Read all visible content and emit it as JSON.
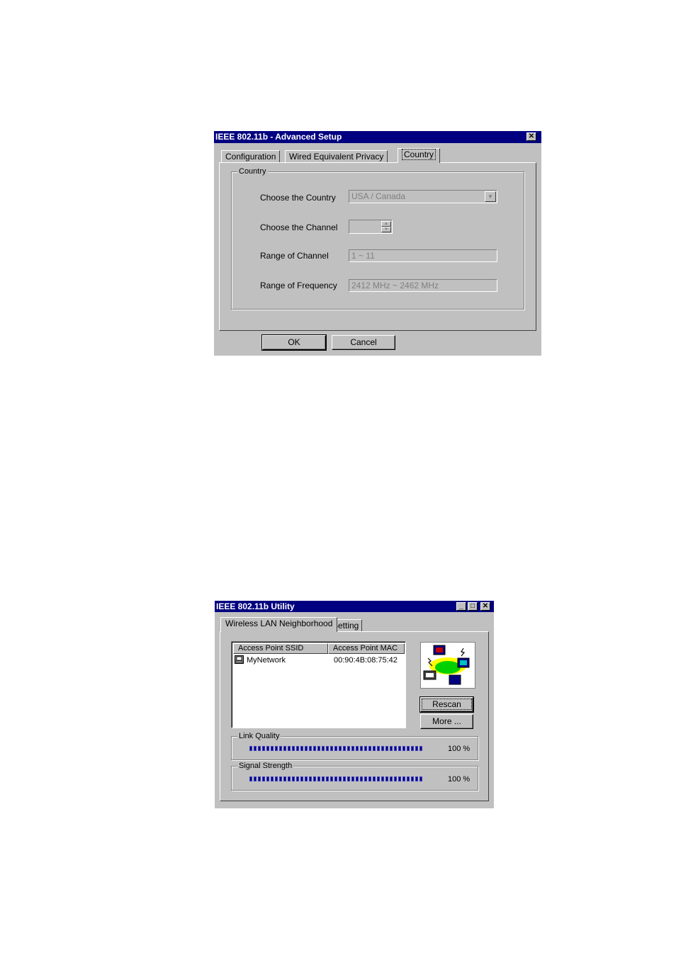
{
  "advanced": {
    "title": "IEEE 802.11b - Advanced Setup",
    "close_glyph": "✕",
    "tabs": [
      {
        "label": "Configuration"
      },
      {
        "label": "Wired Equivalent Privacy"
      },
      {
        "label": "Country"
      }
    ],
    "group_label": "Country",
    "country_label": "Choose the Country",
    "country_value": "USA / Canada",
    "channel_label": "Choose the Channel",
    "channel_value": "",
    "range_channel_label": "Range of Channel",
    "range_channel_value": "1 ~ 11",
    "range_freq_label": "Range of Frequency",
    "range_freq_value": "2412 MHz ~ 2462 MHz",
    "ok_label": "OK",
    "cancel_label": "Cancel"
  },
  "utility": {
    "title": "IEEE 802.11b Utility",
    "tabs": [
      {
        "label": "Wireless LAN Neighborhood"
      },
      {
        "label": "Setting"
      }
    ],
    "columns": [
      "Access Point SSID",
      "Access Point MAC"
    ],
    "rows": [
      {
        "ssid": "MyNetwork",
        "mac": "00:90:4B:08:75:42"
      }
    ],
    "rescan_label": "Rescan",
    "more_label": "More ...",
    "link_quality_label": "Link Quality",
    "link_quality_percent": 100,
    "link_quality_text": "100 %",
    "signal_strength_label": "Signal Strength",
    "signal_strength_percent": 100,
    "signal_strength_text": "100 %",
    "colors": {
      "meter": "#000080",
      "titlebar": "#000080"
    }
  }
}
